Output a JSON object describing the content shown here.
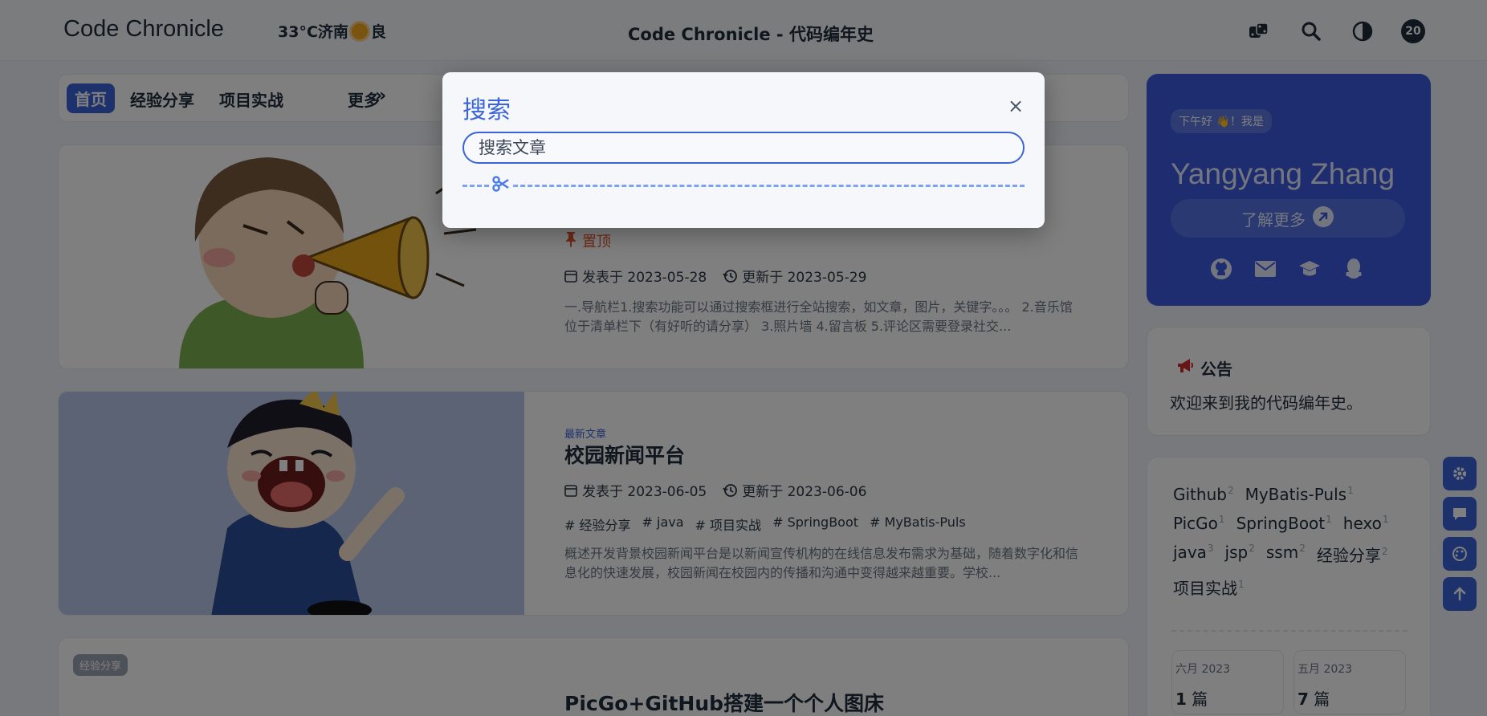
{
  "header": {
    "brand": "Code Chronicle",
    "weather": {
      "temp": "33°C济南",
      "quality": "良"
    },
    "center_title": "Code Chronicle - 代码编年史",
    "icons": [
      "dice-icon",
      "search-icon",
      "theme-toggle-icon"
    ],
    "badge_count": "20"
  },
  "nav": {
    "items": [
      {
        "label": "首页",
        "active": true
      },
      {
        "label": "经验分享"
      },
      {
        "label": "项目实战"
      }
    ],
    "more_icon": "»",
    "more_label": "更多"
  },
  "posts": [
    {
      "pin_label": "置顶",
      "published": "发表于 2023-05-28",
      "updated": "更新于 2023-05-29",
      "excerpt": "一.导航栏1.搜索功能可以通过搜索框进行全站搜索，如文章，图片，关键字。。。 2.音乐馆位于清单栏下（有好听的请分享） 3.照片墙 4.留言板 5.评论区需要登录社交..."
    },
    {
      "badge": "最新文章",
      "title": "校园新闻平台",
      "published": "发表于 2023-06-05",
      "updated": "更新于 2023-06-06",
      "tags": [
        "经验分享",
        "java",
        "项目实战",
        "SpringBoot",
        "MyBatis-Puls"
      ],
      "excerpt": "概述开发背景校园新闻平台是以新闻宣传机构的在线信息发布需求为基础，随着数字化和信息化的快速发展，校园新闻在校园内的传播和沟通中变得越来越重要。学校..."
    },
    {
      "category": "经验分享",
      "title": "PicGo+GitHub搭建一个个人图床"
    }
  ],
  "profile": {
    "greeting": "下午好 👋！我是",
    "name": "Yangyang Zhang",
    "more_button": "了解更多",
    "social_icons": [
      "github-icon",
      "mail-icon",
      "graduation-cap-icon",
      "qq-icon"
    ]
  },
  "notice": {
    "title": "公告",
    "text": "欢迎来到我的代码编年史。"
  },
  "tag_cloud": [
    {
      "name": "Github",
      "count": "2"
    },
    {
      "name": "MyBatis-Puls",
      "count": "1"
    },
    {
      "name": "PicGo",
      "count": "1"
    },
    {
      "name": "SpringBoot",
      "count": "1"
    },
    {
      "name": "hexo",
      "count": "1"
    },
    {
      "name": "java",
      "count": "3"
    },
    {
      "name": "jsp",
      "count": "2"
    },
    {
      "name": "ssm",
      "count": "2"
    },
    {
      "name": "经验分享",
      "count": "2"
    },
    {
      "name": "项目实战",
      "count": "1"
    }
  ],
  "archives": [
    {
      "month": "六月 2023",
      "count": "1",
      "unit": "篇"
    },
    {
      "month": "五月 2023",
      "count": "7",
      "unit": "篇"
    }
  ],
  "float_buttons": [
    "settings-icon",
    "comment-icon",
    "palette-icon",
    "arrow-up-icon"
  ],
  "search_modal": {
    "title": "搜索",
    "close": "×",
    "placeholder": "搜索文章"
  },
  "colors": {
    "accent": "#3a64d8",
    "profile_bg": "#3a5be0",
    "pin": "#e0542b"
  }
}
